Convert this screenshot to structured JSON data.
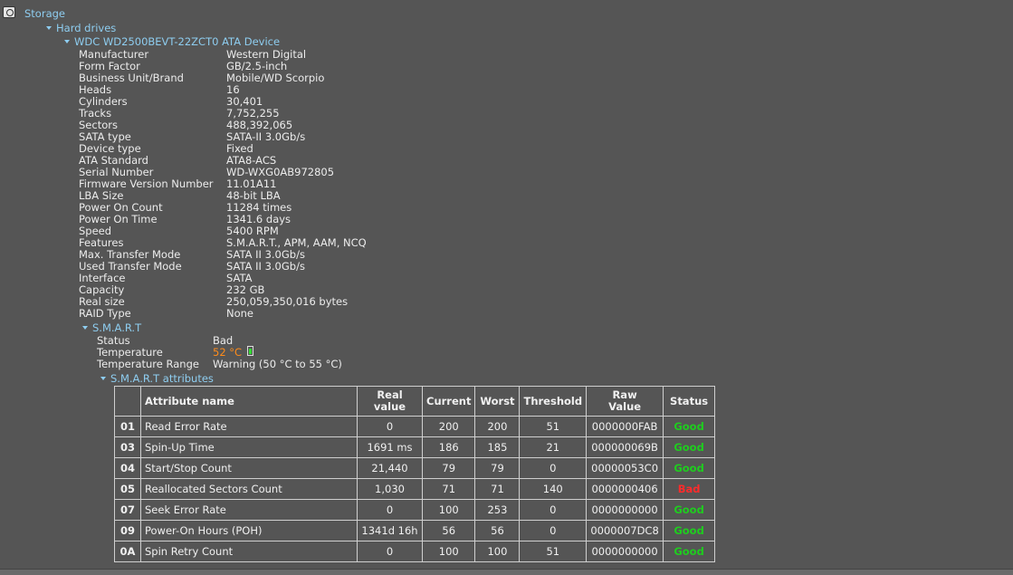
{
  "tree": {
    "root": "Storage",
    "hard_drives": "Hard drives",
    "device": "WDC WD2500BEVT-22ZCT0 ATA Device",
    "smart": "S.M.A.R.T",
    "smart_attributes": "S.M.A.R.T attributes"
  },
  "properties": [
    {
      "k": "Manufacturer",
      "v": "Western Digital"
    },
    {
      "k": "Form Factor",
      "v": "GB/2.5-inch"
    },
    {
      "k": "Business Unit/Brand",
      "v": "Mobile/WD Scorpio"
    },
    {
      "k": "Heads",
      "v": "16"
    },
    {
      "k": "Cylinders",
      "v": "30,401"
    },
    {
      "k": "Tracks",
      "v": "7,752,255"
    },
    {
      "k": "Sectors",
      "v": "488,392,065"
    },
    {
      "k": "SATA type",
      "v": "SATA-II 3.0Gb/s"
    },
    {
      "k": "Device type",
      "v": "Fixed"
    },
    {
      "k": "ATA Standard",
      "v": "ATA8-ACS"
    },
    {
      "k": "Serial Number",
      "v": "WD-WXG0AB972805"
    },
    {
      "k": "Firmware Version Number",
      "v": "11.01A11"
    },
    {
      "k": "LBA Size",
      "v": "48-bit LBA"
    },
    {
      "k": "Power On Count",
      "v": "11284 times"
    },
    {
      "k": "Power On Time",
      "v": "1341.6 days"
    },
    {
      "k": "Speed",
      "v": "5400 RPM"
    },
    {
      "k": "Features",
      "v": "S.M.A.R.T., APM, AAM, NCQ"
    },
    {
      "k": "Max. Transfer Mode",
      "v": "SATA II 3.0Gb/s"
    },
    {
      "k": "Used Transfer Mode",
      "v": "SATA II 3.0Gb/s"
    },
    {
      "k": "Interface",
      "v": "SATA"
    },
    {
      "k": "Capacity",
      "v": "232 GB"
    },
    {
      "k": "Real size",
      "v": "250,059,350,016 bytes"
    },
    {
      "k": "RAID Type",
      "v": "None"
    }
  ],
  "smart": {
    "status_label": "Status",
    "status_value": "Bad",
    "temperature_label": "Temperature",
    "temperature_value": "52 °C",
    "range_label": "Temperature Range",
    "range_value": "Warning (50 °C to 55 °C)"
  },
  "attributes_table": {
    "headers": {
      "name": "Attribute name",
      "real_line1": "Real",
      "real_line2": "value",
      "current": "Current",
      "worst": "Worst",
      "threshold": "Threshold",
      "raw_line1": "Raw",
      "raw_line2": "Value",
      "status": "Status"
    },
    "rows": [
      {
        "id": "01",
        "name": "Read Error Rate",
        "real": "0",
        "current": "200",
        "worst": "200",
        "threshold": "51",
        "raw": "0000000FAB",
        "status": "Good"
      },
      {
        "id": "03",
        "name": "Spin-Up Time",
        "real": "1691 ms",
        "current": "186",
        "worst": "185",
        "threshold": "21",
        "raw": "000000069B",
        "status": "Good"
      },
      {
        "id": "04",
        "name": "Start/Stop Count",
        "real": "21,440",
        "current": "79",
        "worst": "79",
        "threshold": "0",
        "raw": "00000053C0",
        "status": "Good"
      },
      {
        "id": "05",
        "name": "Reallocated Sectors Count",
        "real": "1,030",
        "current": "71",
        "worst": "71",
        "threshold": "140",
        "raw": "0000000406",
        "status": "Bad"
      },
      {
        "id": "07",
        "name": "Seek Error Rate",
        "real": "0",
        "current": "100",
        "worst": "253",
        "threshold": "0",
        "raw": "0000000000",
        "status": "Good"
      },
      {
        "id": "09",
        "name": "Power-On Hours (POH)",
        "real": "1341d 16h",
        "current": "56",
        "worst": "56",
        "threshold": "0",
        "raw": "0000007DC8",
        "status": "Good"
      },
      {
        "id": "0A",
        "name": "Spin Retry Count",
        "real": "0",
        "current": "100",
        "worst": "100",
        "threshold": "51",
        "raw": "0000000000",
        "status": "Good"
      }
    ]
  },
  "colors": {
    "background": "#555555",
    "link": "#8ecdf0",
    "good": "#1fcc1f",
    "bad": "#ff2b2b",
    "temperature": "#ff8c1a"
  }
}
